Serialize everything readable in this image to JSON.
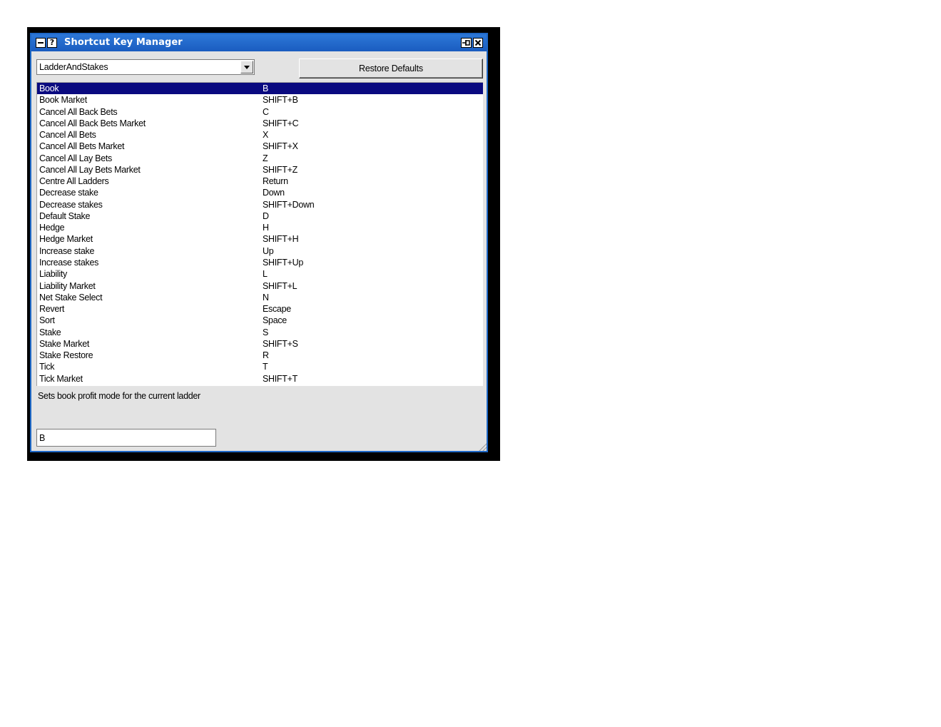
{
  "window": {
    "title": "Shortcut Key Manager",
    "help_label": "?",
    "colors": {
      "titlebar": "#1f68c6",
      "selection": "#0a0a80",
      "background": "#e3e3e3"
    }
  },
  "toolbar": {
    "category_select_value": "LadderAndStakes",
    "restore_defaults_label": "Restore Defaults"
  },
  "shortcuts": [
    {
      "action": "Book",
      "key": "B",
      "selected": true
    },
    {
      "action": "Book Market",
      "key": "SHIFT+B"
    },
    {
      "action": "Cancel All Back Bets",
      "key": "C"
    },
    {
      "action": "Cancel All Back Bets Market",
      "key": "SHIFT+C"
    },
    {
      "action": "Cancel All Bets",
      "key": "X"
    },
    {
      "action": "Cancel All Bets Market",
      "key": "SHIFT+X"
    },
    {
      "action": "Cancel All Lay Bets",
      "key": "Z"
    },
    {
      "action": "Cancel All Lay Bets Market",
      "key": "SHIFT+Z"
    },
    {
      "action": "Centre All Ladders",
      "key": "Return"
    },
    {
      "action": "Decrease stake",
      "key": "Down"
    },
    {
      "action": "Decrease stakes",
      "key": "SHIFT+Down"
    },
    {
      "action": "Default Stake",
      "key": "D"
    },
    {
      "action": "Hedge",
      "key": "H"
    },
    {
      "action": "Hedge Market",
      "key": "SHIFT+H"
    },
    {
      "action": "Increase stake",
      "key": "Up"
    },
    {
      "action": "Increase stakes",
      "key": "SHIFT+Up"
    },
    {
      "action": "Liability",
      "key": "L"
    },
    {
      "action": "Liability Market",
      "key": "SHIFT+L"
    },
    {
      "action": "Net Stake Select",
      "key": "N"
    },
    {
      "action": "Revert",
      "key": "Escape"
    },
    {
      "action": "Sort",
      "key": "Space"
    },
    {
      "action": "Stake",
      "key": "S"
    },
    {
      "action": "Stake Market",
      "key": "SHIFT+S"
    },
    {
      "action": "Stake Restore",
      "key": "R"
    },
    {
      "action": "Tick",
      "key": "T"
    },
    {
      "action": "Tick Market",
      "key": "SHIFT+T"
    }
  ],
  "details": {
    "description": "Sets book profit mode for the current ladder",
    "key_field_value": "B"
  },
  "icons": {
    "minimize": "minimize-icon",
    "help": "help-icon",
    "pin": "pin-icon",
    "close": "close-icon",
    "dropdown": "chevron-down-icon",
    "resize": "resize-grip-icon"
  }
}
